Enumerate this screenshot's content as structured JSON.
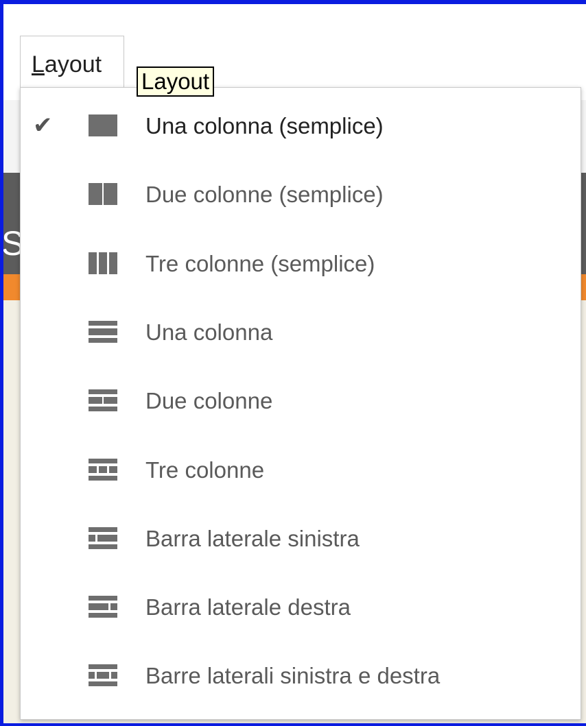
{
  "tab": {
    "label": "Layout",
    "mnemonic": "L"
  },
  "tooltip": {
    "text": "Layout"
  },
  "background": {
    "partial_glyph": "S"
  },
  "colors": {
    "frame": "#0a1ce0",
    "icon": "#6e6e6e",
    "dark_band": "#5c5c5c",
    "orange_band": "#f1892d"
  },
  "menu": {
    "items": [
      {
        "label": "Una colonna (semplice)",
        "icon": "one-column-simple-icon",
        "checked": true
      },
      {
        "label": "Due colonne (semplice)",
        "icon": "two-columns-simple-icon",
        "checked": false
      },
      {
        "label": "Tre colonne (semplice)",
        "icon": "three-columns-simple-icon",
        "checked": false
      },
      {
        "label": "Una colonna",
        "icon": "one-column-icon",
        "checked": false
      },
      {
        "label": "Due colonne",
        "icon": "two-columns-icon",
        "checked": false
      },
      {
        "label": "Tre colonne",
        "icon": "three-columns-icon",
        "checked": false
      },
      {
        "label": "Barra laterale sinistra",
        "icon": "left-sidebar-icon",
        "checked": false
      },
      {
        "label": "Barra laterale destra",
        "icon": "right-sidebar-icon",
        "checked": false
      },
      {
        "label": "Barre laterali sinistra e destra",
        "icon": "left-right-sidebars-icon",
        "checked": false
      }
    ]
  }
}
